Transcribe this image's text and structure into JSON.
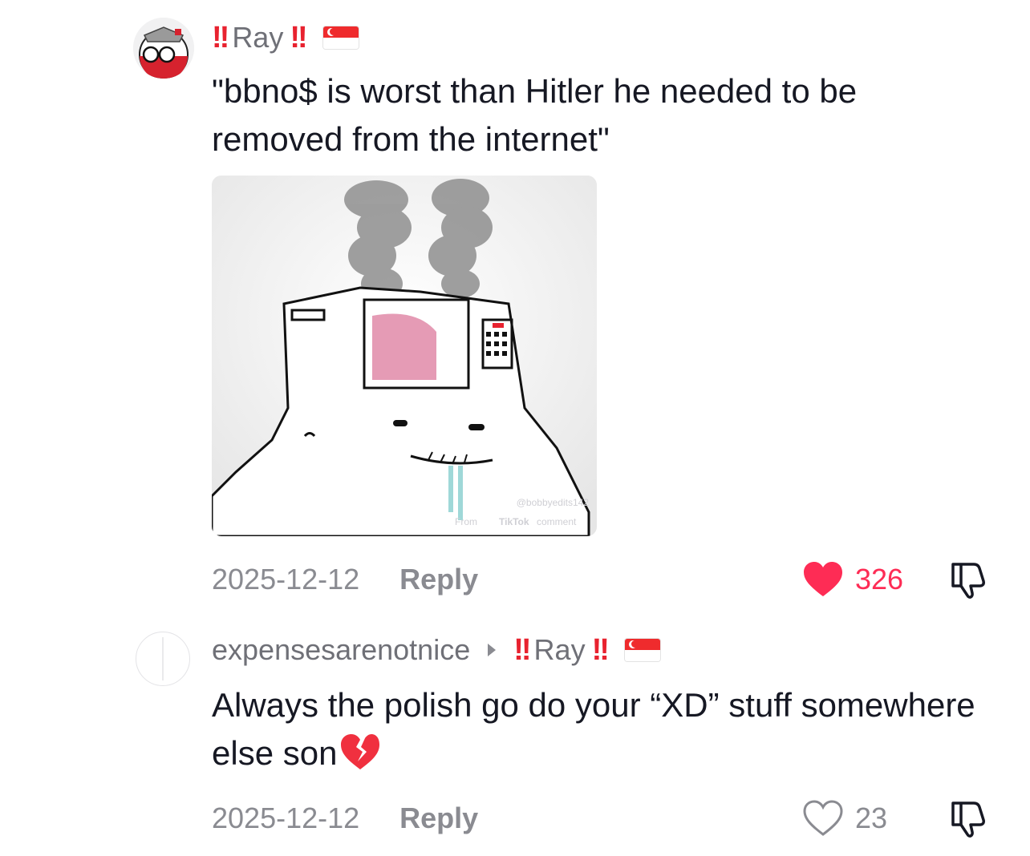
{
  "comments": [
    {
      "author_prefix": "!!",
      "author": "Ray",
      "author_suffix": "!!",
      "text": "\"bbno$ is worst than Hitler he needed to be removed from the internet\"",
      "media": {
        "watermark_handle": "@bobbyedits142",
        "watermark_source": "From",
        "watermark_brand": "TikTok",
        "watermark_suffix": "comment"
      },
      "date": "2025-12-12",
      "reply_label": "Reply",
      "likes": "326",
      "liked": true
    },
    {
      "author": "expensesarenotnice",
      "reply_to_prefix": "!!",
      "reply_to": "Ray",
      "reply_to_suffix": "!!",
      "text": "Always the polish go do your “XD” stuff somewhere else son",
      "date": "2025-12-12",
      "reply_label": "Reply",
      "likes": "23",
      "liked": false
    }
  ],
  "colors": {
    "accent": "#fe2c55",
    "bang": "#e8222f",
    "muted": "#8a8b91"
  }
}
